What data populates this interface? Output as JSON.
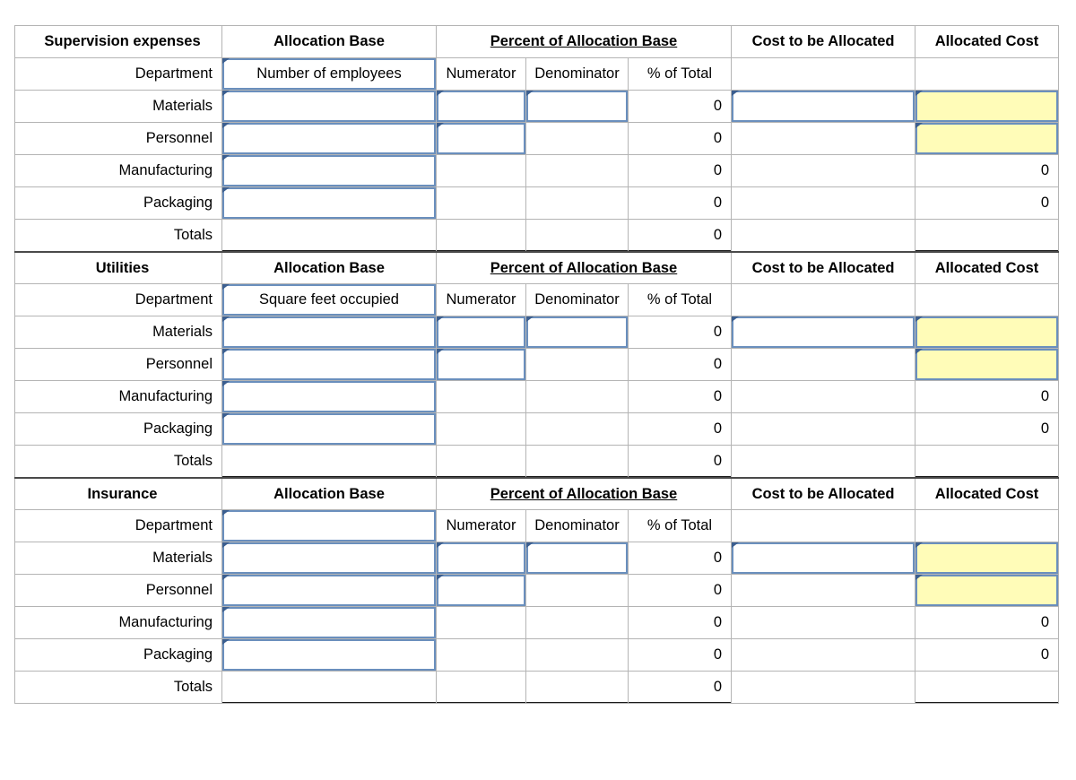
{
  "colors": {
    "header_blue": "#80A9DB",
    "input_border_blue": "#6a8fbd",
    "marker_blue": "#3c5f90",
    "highlight_yellow": "#FFFCB8",
    "grid_gray": "#b4b4b4"
  },
  "columns": {
    "department": "Department",
    "allocation_base": "Allocation Base",
    "percent_group": "Percent of Allocation Base",
    "numerator": "Numerator",
    "denominator": "Denominator",
    "percent_of_total": "% of Total",
    "cost_to_be_allocated": "Cost to be Allocated",
    "allocated_cost": "Allocated Cost"
  },
  "row_labels": {
    "materials": "Materials",
    "personnel": "Personnel",
    "manufacturing": "Manufacturing",
    "packaging": "Packaging",
    "totals": "Totals"
  },
  "sections": [
    {
      "title": "Supervision expenses",
      "allocation_base_value": "Number of employees",
      "rows": [
        {
          "label": "Materials",
          "base": "",
          "numerator": "",
          "denominator": "",
          "percent_of_total": "0",
          "cost": "",
          "allocated": ""
        },
        {
          "label": "Personnel",
          "base": "",
          "numerator": "",
          "denominator": "",
          "percent_of_total": "0",
          "cost": "",
          "allocated": ""
        },
        {
          "label": "Manufacturing",
          "base": "",
          "numerator": "",
          "denominator": "",
          "percent_of_total": "0",
          "cost": "",
          "allocated": "0"
        },
        {
          "label": "Packaging",
          "base": "",
          "numerator": "",
          "denominator": "",
          "percent_of_total": "0",
          "cost": "",
          "allocated": "0"
        }
      ],
      "totals": {
        "label": "Totals",
        "base": "",
        "numerator": "",
        "denominator": "",
        "percent_of_total": "0",
        "cost": "",
        "allocated": ""
      }
    },
    {
      "title": "Utilities",
      "allocation_base_value": "Square feet occupied",
      "rows": [
        {
          "label": "Materials",
          "base": "",
          "numerator": "",
          "denominator": "",
          "percent_of_total": "0",
          "cost": "",
          "allocated": ""
        },
        {
          "label": "Personnel",
          "base": "",
          "numerator": "",
          "denominator": "",
          "percent_of_total": "0",
          "cost": "",
          "allocated": ""
        },
        {
          "label": "Manufacturing",
          "base": "",
          "numerator": "",
          "denominator": "",
          "percent_of_total": "0",
          "cost": "",
          "allocated": "0"
        },
        {
          "label": "Packaging",
          "base": "",
          "numerator": "",
          "denominator": "",
          "percent_of_total": "0",
          "cost": "",
          "allocated": "0"
        }
      ],
      "totals": {
        "label": "Totals",
        "base": "",
        "numerator": "",
        "denominator": "",
        "percent_of_total": "0",
        "cost": "",
        "allocated": ""
      }
    },
    {
      "title": "Insurance",
      "allocation_base_value": "",
      "rows": [
        {
          "label": "Materials",
          "base": "",
          "numerator": "",
          "denominator": "",
          "percent_of_total": "0",
          "cost": "",
          "allocated": ""
        },
        {
          "label": "Personnel",
          "base": "",
          "numerator": "",
          "denominator": "",
          "percent_of_total": "0",
          "cost": "",
          "allocated": ""
        },
        {
          "label": "Manufacturing",
          "base": "",
          "numerator": "",
          "denominator": "",
          "percent_of_total": "0",
          "cost": "",
          "allocated": "0"
        },
        {
          "label": "Packaging",
          "base": "",
          "numerator": "",
          "denominator": "",
          "percent_of_total": "0",
          "cost": "",
          "allocated": "0"
        }
      ],
      "totals": {
        "label": "Totals",
        "base": "",
        "numerator": "",
        "denominator": "",
        "percent_of_total": "0",
        "cost": "",
        "allocated": ""
      }
    }
  ]
}
